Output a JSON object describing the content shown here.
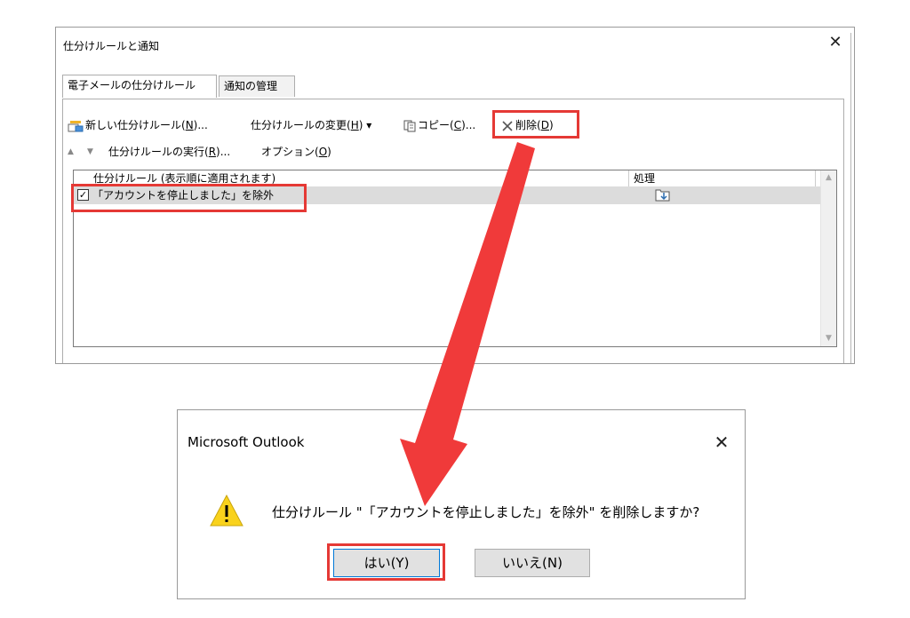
{
  "rules_window": {
    "title": "仕分けルールと通知",
    "close_glyph": "✕",
    "tabs": [
      {
        "label": "電子メールの仕分けルール",
        "active": true
      },
      {
        "label": "通知の管理",
        "active": false
      }
    ],
    "toolbar": {
      "new_rule": {
        "prefix": "新しい仕分けルール(",
        "key": "N",
        "suffix": ")..."
      },
      "change_rule": {
        "prefix": "仕分けルールの変更(",
        "key": "H",
        "suffix": ")",
        "dropdown": "▾"
      },
      "copy": {
        "prefix": "コピー(",
        "key": "C",
        "suffix": ")..."
      },
      "delete": {
        "prefix": "削除(",
        "key": "D",
        "suffix": ")"
      }
    },
    "row2": {
      "up_glyph": "▲",
      "down_glyph": "▼",
      "run_rules": {
        "prefix": "仕分けルールの実行(",
        "key": "R",
        "suffix": ")..."
      },
      "options": {
        "prefix": "オプション(",
        "key": "O",
        "suffix": ")"
      }
    },
    "columns": {
      "rule": "仕分けルール (表示順に適用されます)",
      "action": "処理"
    },
    "rules": [
      {
        "name": "「アカウントを停止しました」を除外",
        "checked": true,
        "check_glyph": "✓"
      }
    ],
    "scroll_up_glyph": "▲",
    "scroll_down_glyph": "▼"
  },
  "confirm_dialog": {
    "title": "Microsoft Outlook",
    "close_glyph": "✕",
    "message": "仕分けルール \"「アカウントを停止しました」を除外\" を削除しますか?",
    "yes_label": "はい(Y)",
    "no_label": "いいえ(N)",
    "warning_glyph": "!"
  },
  "colors": {
    "highlight": "#e53935",
    "arrow": "#f03a3a",
    "warning_fill": "#f9d21c"
  }
}
